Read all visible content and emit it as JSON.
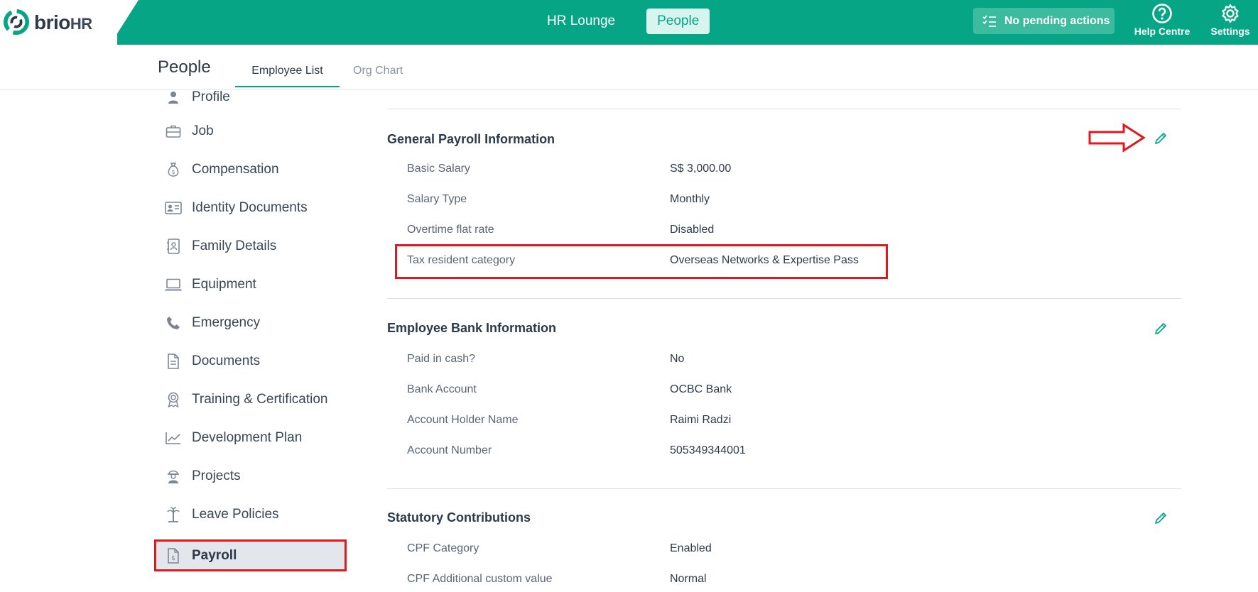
{
  "app": {
    "brand_main": "brio",
    "brand_suffix": "HR"
  },
  "nav": {
    "items": [
      {
        "label": "HR Lounge"
      },
      {
        "label": "People"
      }
    ]
  },
  "header": {
    "pending_label": "No pending actions",
    "help_label": "Help Centre",
    "settings_label": "Settings"
  },
  "subheader": {
    "title": "People",
    "tabs": [
      {
        "label": "Employee List"
      },
      {
        "label": "Org Chart"
      }
    ]
  },
  "sidebar": {
    "items": [
      {
        "label": "Profile",
        "icon": "person-icon"
      },
      {
        "label": "Job",
        "icon": "briefcase-icon"
      },
      {
        "label": "Compensation",
        "icon": "money-bag-icon"
      },
      {
        "label": "Identity Documents",
        "icon": "id-card-icon"
      },
      {
        "label": "Family Details",
        "icon": "contact-book-icon"
      },
      {
        "label": "Equipment",
        "icon": "laptop-icon"
      },
      {
        "label": "Emergency",
        "icon": "phone-icon"
      },
      {
        "label": "Documents",
        "icon": "document-icon"
      },
      {
        "label": "Training & Certification",
        "icon": "award-icon"
      },
      {
        "label": "Development Plan",
        "icon": "trend-chart-icon"
      },
      {
        "label": "Projects",
        "icon": "worker-icon"
      },
      {
        "label": "Leave Policies",
        "icon": "beach-icon"
      },
      {
        "label": "Payroll",
        "icon": "payslip-icon"
      }
    ],
    "active": "Payroll"
  },
  "sections": {
    "general": {
      "title": "General Payroll Information",
      "rows": [
        {
          "label": "Basic Salary",
          "value": "S$ 3,000.00"
        },
        {
          "label": "Salary Type",
          "value": "Monthly"
        },
        {
          "label": "Overtime flat rate",
          "value": "Disabled"
        },
        {
          "label": "Tax resident category",
          "value": "Overseas Networks & Expertise Pass"
        }
      ]
    },
    "bank": {
      "title": "Employee Bank Information",
      "rows": [
        {
          "label": "Paid in cash?",
          "value": "No"
        },
        {
          "label": "Bank Account",
          "value": "OCBC Bank"
        },
        {
          "label": "Account Holder Name",
          "value": "Raimi Radzi"
        },
        {
          "label": "Account Number",
          "value": "505349344001"
        }
      ]
    },
    "statutory": {
      "title": "Statutory Contributions",
      "rows": [
        {
          "label": "CPF Category",
          "value": "Enabled"
        },
        {
          "label": "CPF Additional custom value",
          "value": "Normal"
        }
      ]
    }
  },
  "colors": {
    "brand": "#05a585",
    "annotation": "#e0191f"
  }
}
